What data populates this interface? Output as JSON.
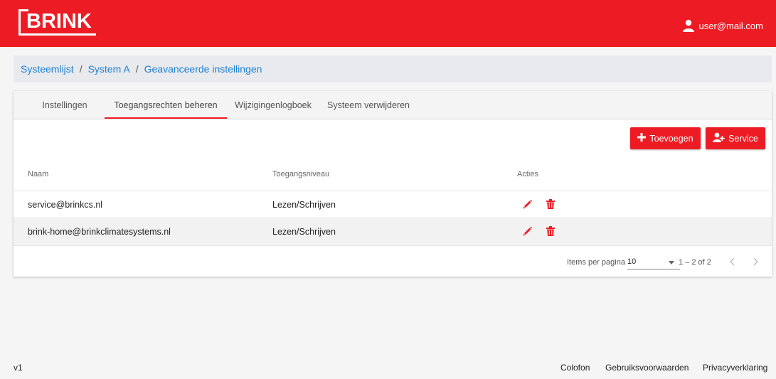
{
  "header": {
    "logo_text": "BRINK",
    "user_email": "user@mail.com",
    "brand_color": "#ed1c24"
  },
  "breadcrumb": {
    "items": [
      "Systeemlijst",
      "System A",
      "Geavanceerde instellingen"
    ],
    "separator": "/"
  },
  "tabs": [
    {
      "label": "Instellingen",
      "active": false
    },
    {
      "label": "Toegangsrechten beheren",
      "active": true
    },
    {
      "label": "Wijzigingenlogboek",
      "active": false
    },
    {
      "label": "Systeem verwijderen",
      "active": false
    }
  ],
  "actions": {
    "add_label": "Toevoegen",
    "service_label": "Service",
    "add_icon": "plus-icon",
    "service_icon": "user-plus-icon"
  },
  "table": {
    "columns": [
      "Naam",
      "Toegangsniveau",
      "Acties"
    ],
    "rows": [
      {
        "name": "service@brinkcs.nl",
        "level": "Lezen/Schrijven"
      },
      {
        "name": "brink-home@brinkclimatesystems.nl",
        "level": "Lezen/Schrijven"
      }
    ],
    "row_actions": [
      "pencil-icon",
      "trash-icon"
    ]
  },
  "pagination": {
    "items_per_page_label": "Items per pagina",
    "items_per_page_value": "10",
    "range": "1 – 2 of 2"
  },
  "footer": {
    "version": "v1",
    "links": [
      "Colofon",
      "Gebruiksvoorwaarden",
      "Privacyverklaring"
    ]
  }
}
